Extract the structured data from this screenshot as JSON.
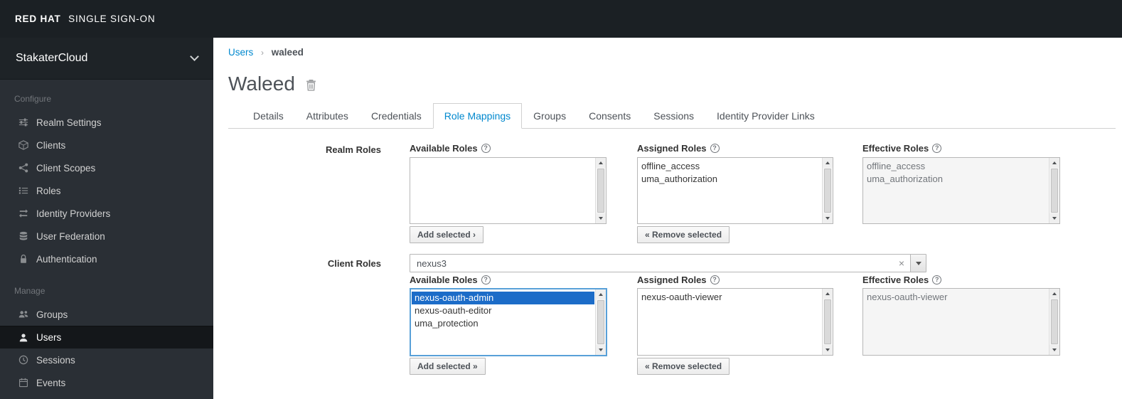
{
  "colors": {
    "accent_blue": "#0088ce",
    "selection_blue": "#1c6cc8",
    "header_bg": "#1b2024",
    "sidebar_bg": "#2a2f35"
  },
  "glyphs": {
    "help": "?",
    "clear": "×",
    "breadcrumb_separator": "›"
  },
  "header": {
    "brand_primary": "RED HAT",
    "brand_secondary": "SINGLE SIGN-ON"
  },
  "sidebar": {
    "realm_selector": {
      "value": "StakaterCloud",
      "icon": "chevron-down-icon"
    },
    "sections": [
      {
        "label": "Configure",
        "items": [
          {
            "label": "Realm Settings",
            "icon": "sliders-icon"
          },
          {
            "label": "Clients",
            "icon": "cube-icon"
          },
          {
            "label": "Client Scopes",
            "icon": "share-icon"
          },
          {
            "label": "Roles",
            "icon": "list-icon"
          },
          {
            "label": "Identity Providers",
            "icon": "exchange-icon"
          },
          {
            "label": "User Federation",
            "icon": "database-icon"
          },
          {
            "label": "Authentication",
            "icon": "lock-icon"
          }
        ]
      },
      {
        "label": "Manage",
        "items": [
          {
            "label": "Groups",
            "icon": "users-group-icon"
          },
          {
            "label": "Users",
            "icon": "user-icon",
            "active": true
          },
          {
            "label": "Sessions",
            "icon": "clock-icon"
          },
          {
            "label": "Events",
            "icon": "calendar-icon"
          }
        ]
      }
    ]
  },
  "main": {
    "breadcrumb": {
      "link": "Users",
      "current": "waleed"
    },
    "title": "Waleed",
    "tabs": [
      "Details",
      "Attributes",
      "Credentials",
      "Role Mappings",
      "Groups",
      "Consents",
      "Sessions",
      "Identity Provider Links"
    ],
    "active_tab": "Role Mappings",
    "realm_roles": {
      "label": "Realm Roles",
      "available_header": "Available Roles",
      "assigned_header": "Assigned Roles",
      "effective_header": "Effective Roles",
      "available_items": [],
      "assigned_items": [
        "offline_access",
        "uma_authorization"
      ],
      "effective_items": [
        "offline_access",
        "uma_authorization"
      ],
      "add_button": "Add selected ›",
      "remove_button": "« Remove selected"
    },
    "client_roles": {
      "label": "Client Roles",
      "client_select_value": "nexus3",
      "available_header": "Available Roles",
      "assigned_header": "Assigned Roles",
      "effective_header": "Effective Roles",
      "available_items": [
        "nexus-oauth-admin",
        "nexus-oauth-editor",
        "uma_protection"
      ],
      "selected_available_item": "nexus-oauth-admin",
      "assigned_items": [
        "nexus-oauth-viewer"
      ],
      "effective_items": [
        "nexus-oauth-viewer"
      ],
      "add_button": "Add selected »",
      "remove_button": "« Remove selected"
    }
  }
}
